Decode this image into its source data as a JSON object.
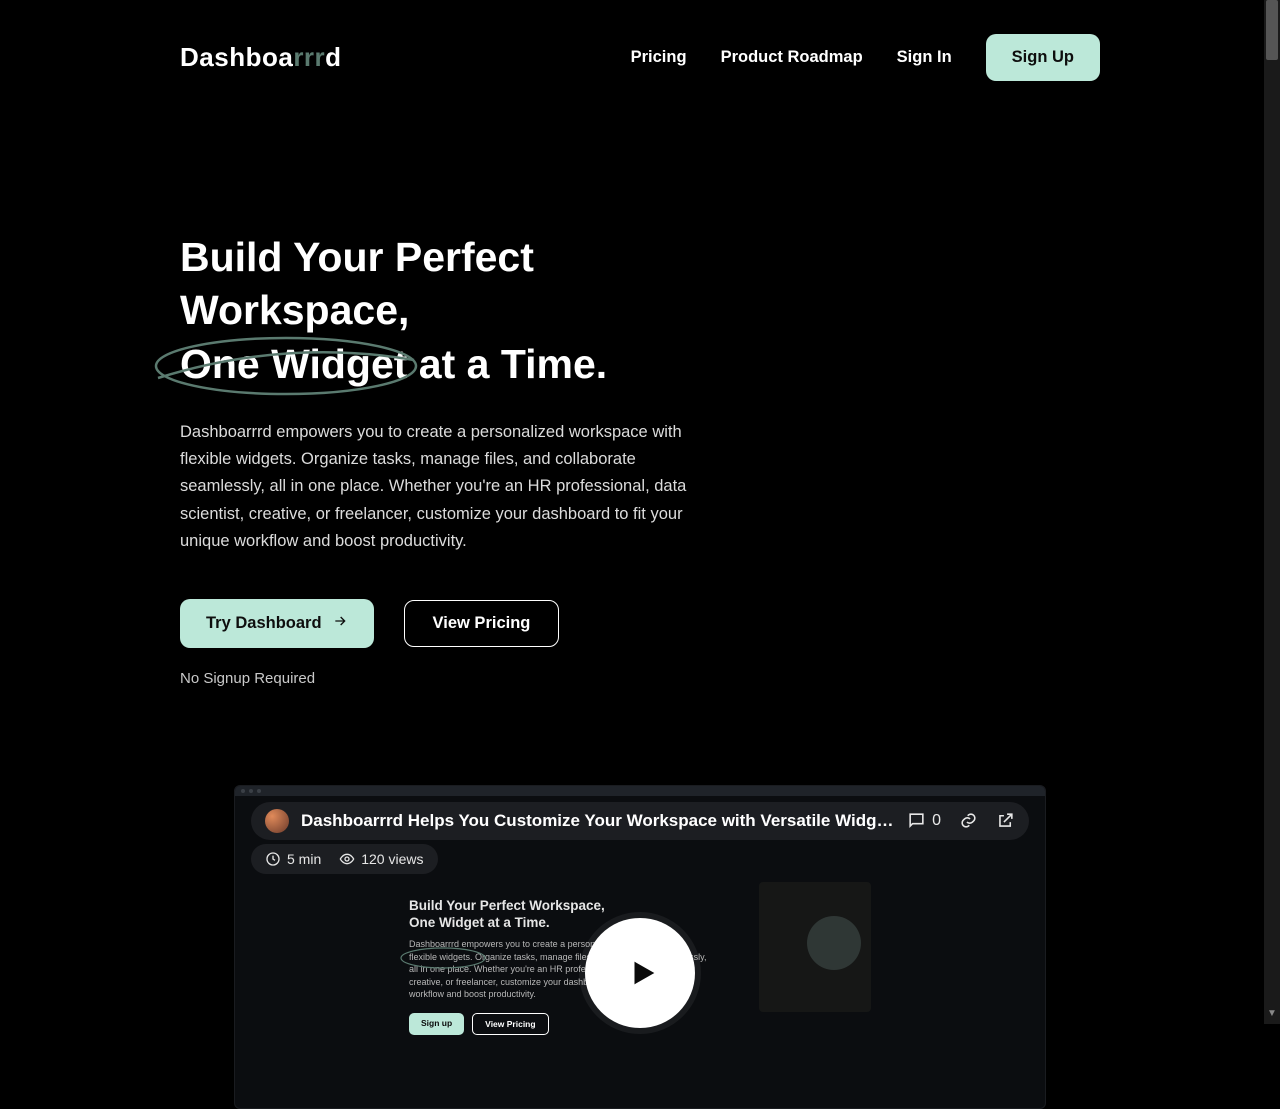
{
  "brand": {
    "part1": "Dashboa",
    "part2": "rrr",
    "part3": "d"
  },
  "nav": {
    "pricing": "Pricing",
    "roadmap": "Product Roadmap",
    "signin": "Sign In",
    "signup": "Sign Up"
  },
  "hero": {
    "title_line1": "Build Your Perfect Workspace,",
    "title_highlight": "One Widget",
    "title_line2_rest": " at a Time.",
    "body": "Dashboarrrd empowers you to create a personalized workspace with flexible widgets. Organize tasks, manage files, and collaborate seamlessly, all in one place. Whether you're an HR professional, data scientist, creative, or freelancer, customize your dashboard to fit your unique workflow and boost productivity.",
    "cta_try": "Try Dashboard",
    "cta_pricing": "View Pricing",
    "subnote": "No Signup Required"
  },
  "video": {
    "title": "Dashboarrrd Helps You Customize Your Workspace with Versatile Widg…",
    "comments": "0",
    "duration": "5 min",
    "views": "120 views",
    "mini": {
      "h1": "Build Your Perfect Workspace,",
      "h2": "One Widget at a Time.",
      "body": "Dashboarrrd empowers you to create a personalized workspace with flexible widgets. Organize tasks, manage files, and collaborate seamlessly, all in one place. Whether you're an HR professional, data scientist, creative, or freelancer, customize your dashboard to fit your unique workflow and boost productivity.",
      "btn1": "Sign up",
      "btn2": "View Pricing"
    }
  },
  "colors": {
    "accent": "#bce8d9"
  }
}
